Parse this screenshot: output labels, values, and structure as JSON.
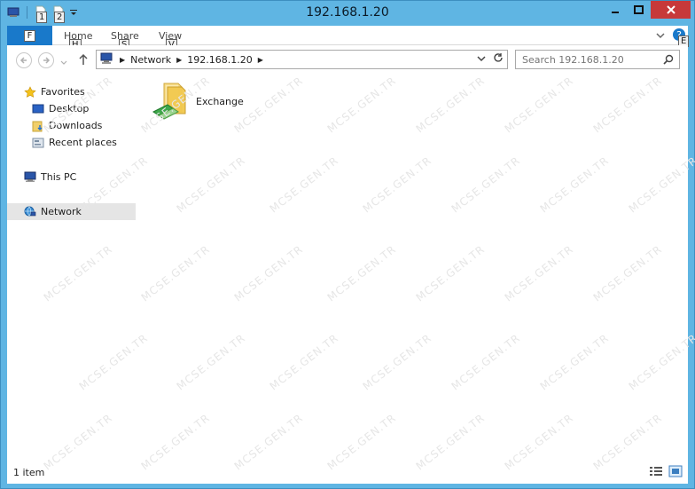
{
  "window": {
    "title": "192.168.1.20"
  },
  "qat": {
    "keytips": [
      "1",
      "2"
    ]
  },
  "ribbon": {
    "file_keytip": "F",
    "tabs": [
      {
        "label": "Home",
        "keytip": "H"
      },
      {
        "label": "Share",
        "keytip": "S"
      },
      {
        "label": "View",
        "keytip": "V"
      }
    ],
    "help_keytip": "E"
  },
  "address": {
    "crumbs": [
      "Network",
      "192.168.1.20"
    ]
  },
  "search": {
    "placeholder": "Search 192.168.1.20"
  },
  "nav": {
    "favorites": "Favorites",
    "desktop": "Desktop",
    "downloads": "Downloads",
    "recent": "Recent places",
    "this_pc": "This PC",
    "network": "Network"
  },
  "content": {
    "items": [
      {
        "label": "Exchange",
        "icon": "shared-folder-icon"
      }
    ]
  },
  "status": {
    "text": "1 item"
  },
  "watermark": "MCSE.GEN.TR",
  "colors": {
    "titlebar": "#5fb5e3",
    "file_tab": "#1979ca",
    "close": "#c7393a",
    "selected": "#e5e5e5"
  }
}
